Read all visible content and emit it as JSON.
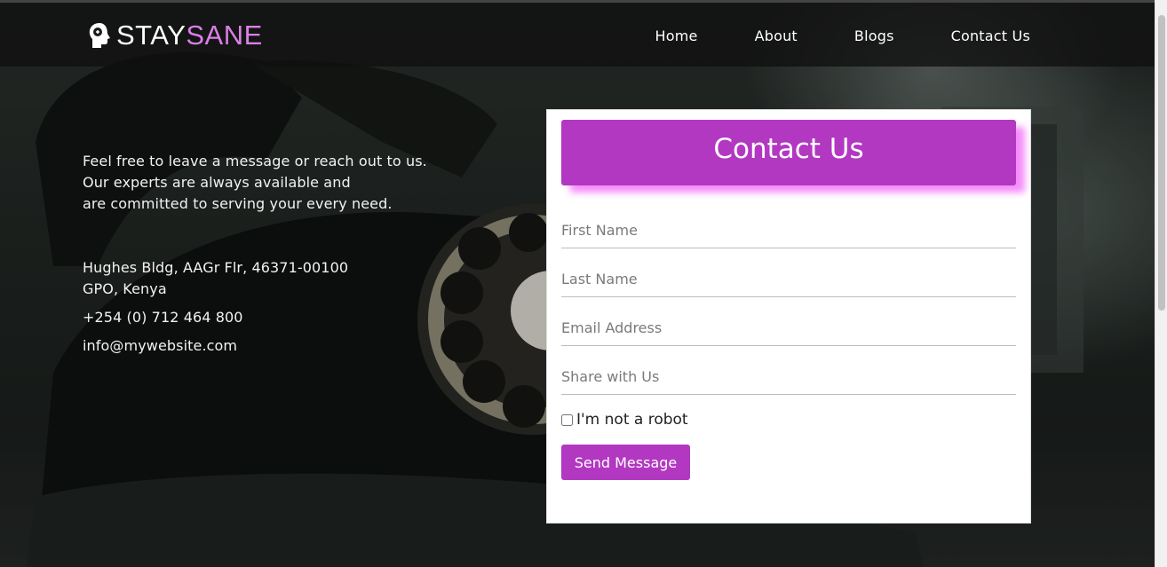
{
  "brand": {
    "part1": "STAY",
    "part2": "SANE"
  },
  "nav": [
    {
      "label": "Home"
    },
    {
      "label": "About"
    },
    {
      "label": "Blogs"
    },
    {
      "label": "Contact Us"
    }
  ],
  "info": {
    "intro_lines": [
      "Feel free to leave a message or reach out to us.",
      "Our experts are always available and",
      "are committed to serving your every need."
    ],
    "address": "Hughes Bldg, AAGr Flr, 46371-00100 GPO, Kenya",
    "phone": "+254 (0) 712 464 800",
    "email": "info@mywebsite.com"
  },
  "form": {
    "title": "Contact Us",
    "first_name_placeholder": "First Name",
    "last_name_placeholder": "Last Name",
    "email_placeholder": "Email Address",
    "message_placeholder": "Share with Us",
    "robot_label": "I'm not a robot",
    "submit_label": "Send Message"
  },
  "colors": {
    "accent": "#b238c2",
    "brand_secondary": "#d97fe6",
    "title_shadow": "#f578fa"
  },
  "icons": {
    "logo": "head-silhouette-icon"
  }
}
